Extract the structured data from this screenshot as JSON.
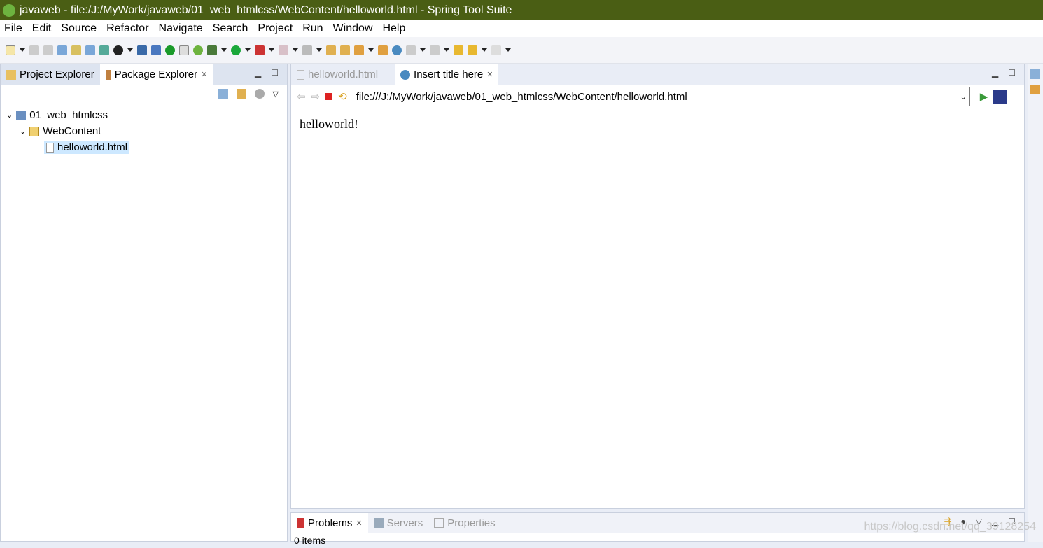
{
  "window": {
    "title": "javaweb - file:/J:/MyWork/javaweb/01_web_htmlcss/WebContent/helloworld.html - Spring Tool Suite"
  },
  "menu": [
    "File",
    "Edit",
    "Source",
    "Refactor",
    "Navigate",
    "Search",
    "Project",
    "Run",
    "Window",
    "Help"
  ],
  "left_panel": {
    "tabs": [
      {
        "label": "Project Explorer"
      },
      {
        "label": "Package Explorer",
        "active": true
      }
    ],
    "tree": [
      {
        "label": "01_web_htmlcss",
        "icon": "project-icon"
      },
      {
        "label": "WebContent",
        "icon": "folder-open-icon"
      },
      {
        "label": "helloworld.html",
        "icon": "file-icon",
        "selected": true
      }
    ]
  },
  "editor": {
    "tabs": [
      {
        "label": "helloworld.html"
      },
      {
        "label": "Insert title here",
        "active": true
      }
    ],
    "url": "file:///J:/MyWork/javaweb/01_web_htmlcss/WebContent/helloworld.html",
    "content": "helloworld!"
  },
  "bottom_panel": {
    "tabs": [
      {
        "label": "Problems",
        "active": true
      },
      {
        "label": "Servers"
      },
      {
        "label": "Properties"
      }
    ],
    "status": "0 items"
  },
  "watermark": "https://blog.csdn.net/qq_39128254"
}
